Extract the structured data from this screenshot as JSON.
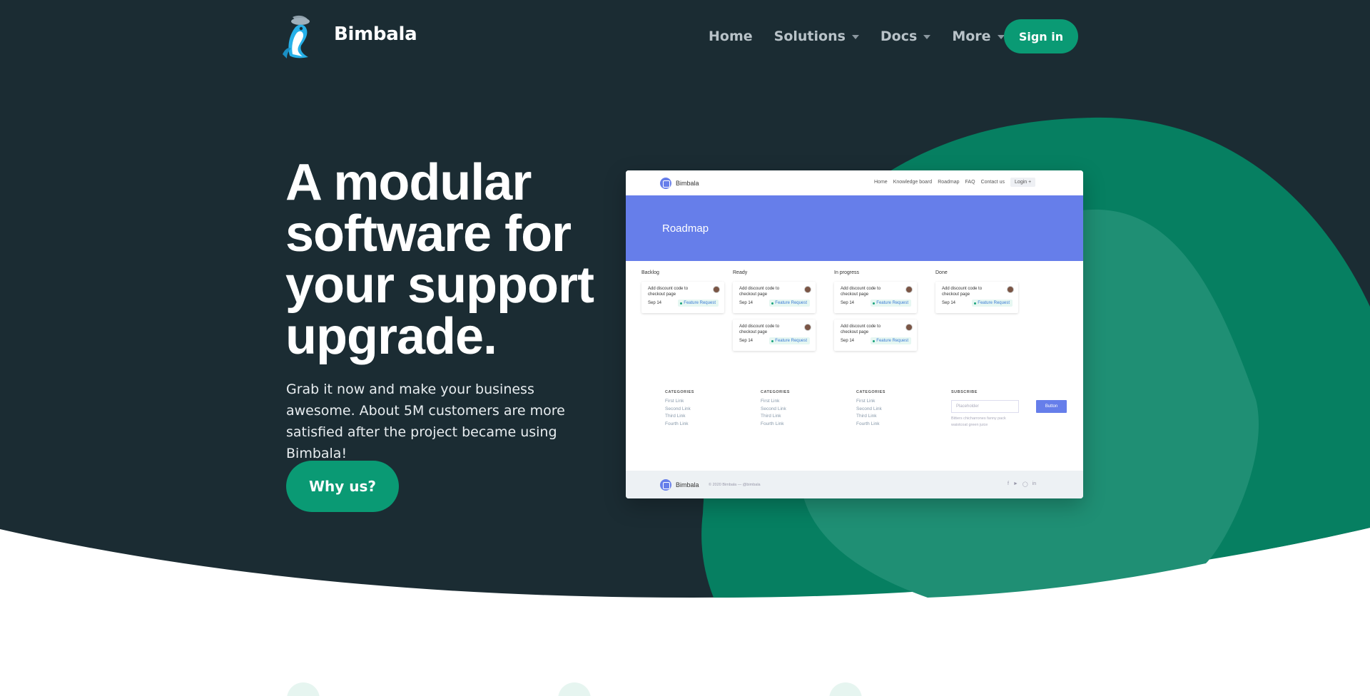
{
  "brand": {
    "name": "Bimbala"
  },
  "nav": {
    "items": [
      {
        "label": "Home",
        "dropdown": false
      },
      {
        "label": "Solutions",
        "dropdown": true
      },
      {
        "label": "Docs",
        "dropdown": true
      },
      {
        "label": "More",
        "dropdown": true
      }
    ],
    "signin_label": "Sign in"
  },
  "hero": {
    "headline_lines": [
      "A modular",
      "software for",
      "your support",
      "upgrade."
    ],
    "subtext": "Grab it now and make your business awesome. About 5M customers are more satisfied after the project became using Bimbala!",
    "cta_label": "Why us?"
  },
  "mockup": {
    "brand": "Bimbala",
    "nav_links": [
      "Home",
      "Knowledge board",
      "Roadmap",
      "FAQ",
      "Contact us"
    ],
    "login_label": "Login +",
    "banner_title": "Roadmap",
    "columns": [
      {
        "title": "Backlog",
        "cards": [
          {
            "title": "Add discount code to checkout page",
            "date": "Sep 14",
            "tag": "Feature Request"
          }
        ]
      },
      {
        "title": "Ready",
        "cards": [
          {
            "title": "Add discount code to checkout page",
            "date": "Sep 14",
            "tag": "Feature Request"
          },
          {
            "title": "Add discount code to checkout page",
            "date": "Sep 14",
            "tag": "Feature Request"
          }
        ]
      },
      {
        "title": "In progress",
        "cards": [
          {
            "title": "Add discount code to checkout page",
            "date": "Sep 14",
            "tag": "Feature Request"
          },
          {
            "title": "Add discount code to checkout page",
            "date": "Sep 14",
            "tag": "Feature Request"
          }
        ]
      },
      {
        "title": "Done",
        "cards": [
          {
            "title": "Add discount code to checkout page",
            "date": "Sep 14",
            "tag": "Feature Request"
          }
        ]
      }
    ],
    "footer_columns": [
      {
        "heading": "CATEGORIES",
        "links": [
          "First Link",
          "Second Link",
          "Third Link",
          "Fourth Link"
        ]
      },
      {
        "heading": "CATEGORIES",
        "links": [
          "First Link",
          "Second Link",
          "Third Link",
          "Fourth Link"
        ]
      },
      {
        "heading": "CATEGORIES",
        "links": [
          "First Link",
          "Second Link",
          "Third Link",
          "Fourth Link"
        ]
      }
    ],
    "subscribe": {
      "heading": "SUBSCRIBE",
      "placeholder": "Placeholder",
      "button_label": "Button",
      "note": "Bitters chicharrones fanny pack waistcoat green juice"
    },
    "footer_copy": "© 2020 Bimbala — @bimbala",
    "social_icons": [
      "facebook-icon",
      "twitter-icon",
      "instagram-icon",
      "linkedin-icon"
    ]
  },
  "colors": {
    "background_dark": "#1b2c33",
    "accent_green": "#0a9a74",
    "mock_indigo": "#667eea"
  }
}
